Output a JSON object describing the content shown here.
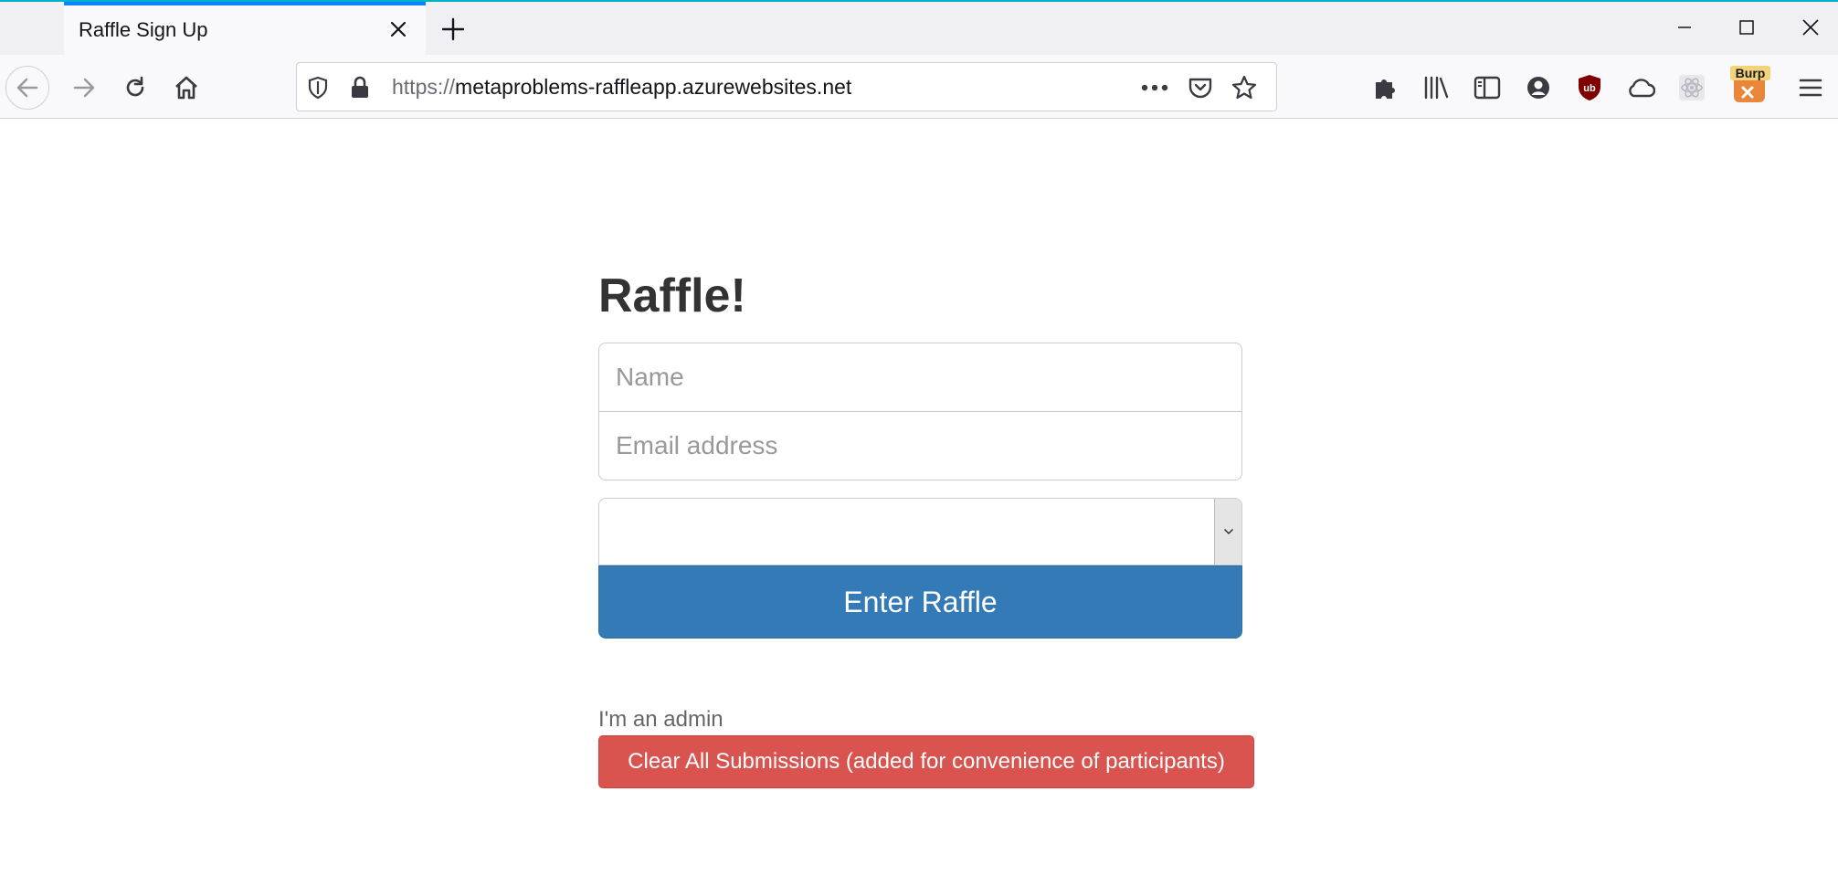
{
  "browser": {
    "tab_title": "Raffle Sign Up",
    "url_prefix": "https://",
    "url_host": "metaproblems-raffleapp.azurewebsites.net",
    "extension_badge": "Burp",
    "accent_color": "#0a84ff"
  },
  "page": {
    "title": "Raffle!",
    "name_placeholder": "Name",
    "email_placeholder": "Email address",
    "select_value": "",
    "enter_button": "Enter Raffle",
    "admin_label": "I'm an admin",
    "clear_button": "Clear All Submissions (added for convenience of participants)",
    "primary_color": "#337ab7",
    "danger_color": "#d9534f"
  }
}
